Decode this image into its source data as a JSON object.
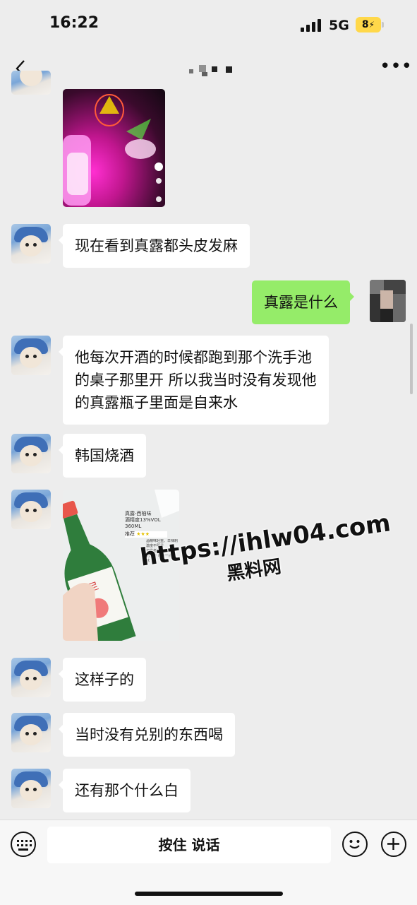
{
  "status": {
    "time": "16:22",
    "network": "5G",
    "battery": "8"
  },
  "nav": {
    "back_icon": "chevron-left-icon",
    "more_icon": "more-dots-icon"
  },
  "messages": [
    {
      "side": "left",
      "type": "image",
      "desc": "pink-lit video frame"
    },
    {
      "side": "left",
      "type": "text",
      "text": "现在看到真露都头皮发麻"
    },
    {
      "side": "right",
      "type": "text",
      "text": "真露是什么"
    },
    {
      "side": "left",
      "type": "text",
      "text": "他每次开酒的时候都跑到那个洗手池\n的桌子那里开 所以我当时没有发现他\n的真露瓶子里面是自来水"
    },
    {
      "side": "left",
      "type": "text",
      "text": "韩国烧酒"
    },
    {
      "side": "left",
      "type": "image",
      "desc": "soju bottle photo"
    },
    {
      "side": "left",
      "type": "text",
      "text": "这样子的"
    },
    {
      "side": "left",
      "type": "text",
      "text": "当时没有兑别的东西喝"
    },
    {
      "side": "left",
      "type": "text",
      "text": "还有那个什么白"
    }
  ],
  "bottle_image": {
    "caption_lines": [
      "真露-西柚味",
      "酒精度13%VOL",
      "360ML"
    ],
    "rating_label": "推荐",
    "notes": "酒精味轻重、辛辣刺激度不明显\n初尝者有酸水混合\n甜度好 略带一点苦味"
  },
  "watermark": {
    "url": "https://ihlw04.com",
    "name": "黑料网"
  },
  "input": {
    "hold_to_talk": "按住 说话"
  },
  "colors": {
    "self_bubble": "#95ec69",
    "bg": "#ededed",
    "battery": "#ffd84a"
  }
}
